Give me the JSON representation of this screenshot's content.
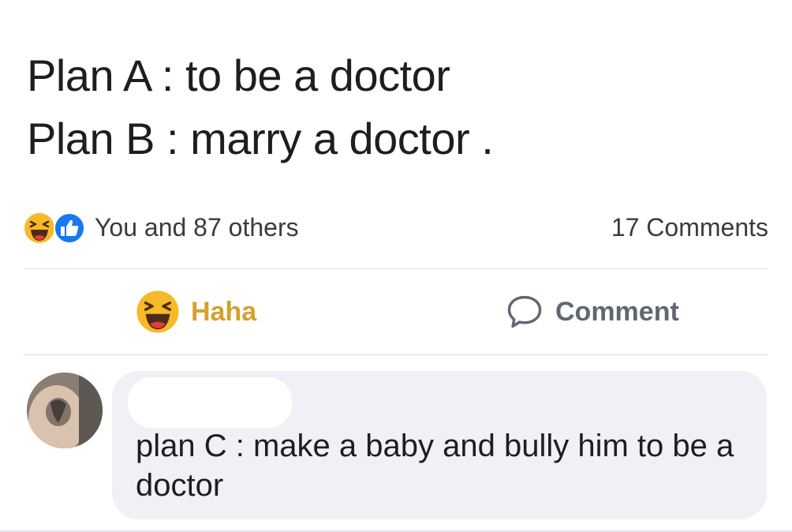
{
  "post": {
    "line1": "Plan A : to be a doctor",
    "line2": "Plan B : marry a doctor ."
  },
  "stats": {
    "reactions_text": "You and 87 others",
    "comments_count": "17 Comments",
    "reaction_icons": [
      "haha-icon",
      "like-icon"
    ]
  },
  "actions": {
    "haha_label": "Haha",
    "comment_label": "Comment"
  },
  "comment": {
    "text": "plan C : make a baby and bully him to be a doctor"
  },
  "colors": {
    "haha_label": "#d4a12f",
    "like_blue": "#1877f2",
    "bubble_bg": "#eff1f5",
    "text": "#1c1e21"
  }
}
